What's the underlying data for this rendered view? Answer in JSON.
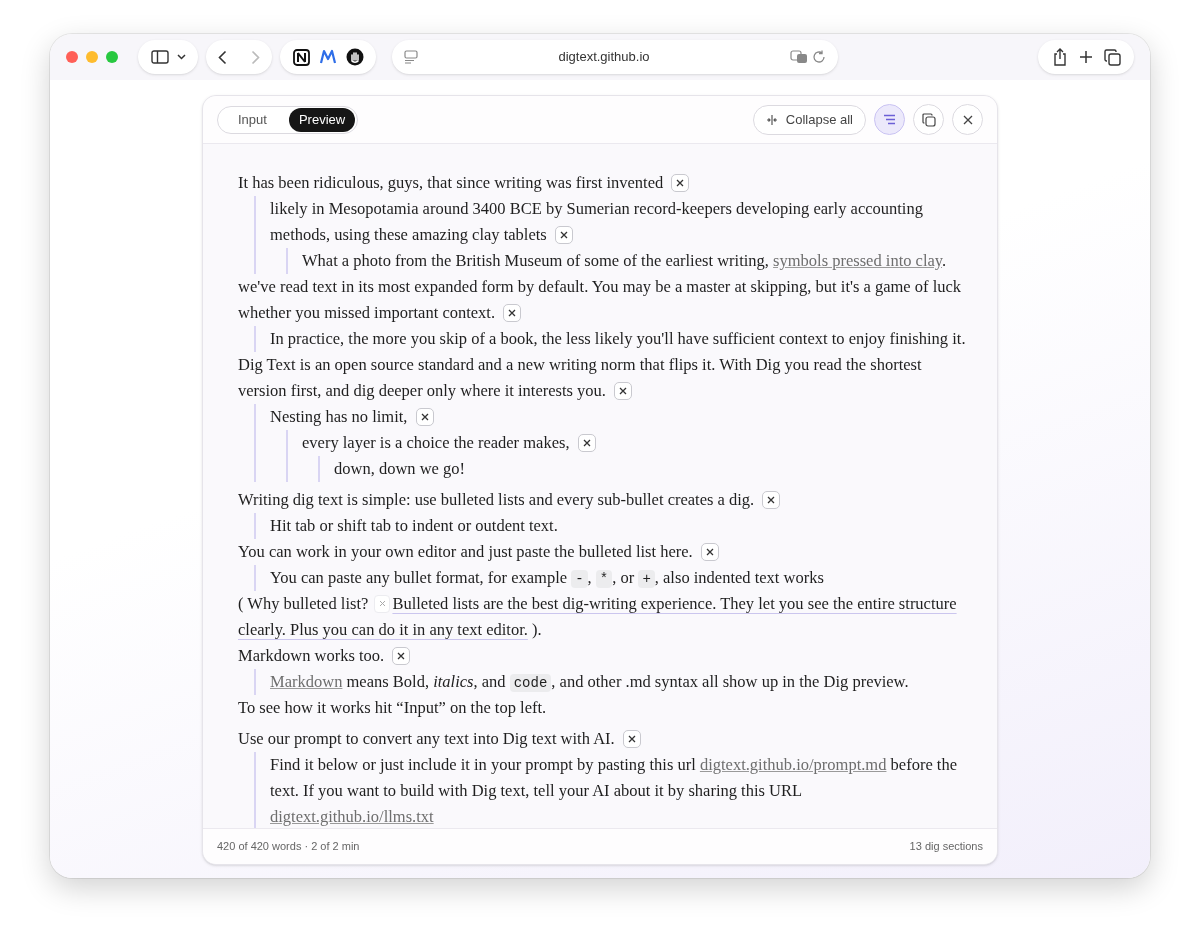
{
  "browser": {
    "url": "digtext.github.io"
  },
  "tabs": [
    {
      "label": "Input",
      "selected": false
    },
    {
      "label": "Preview",
      "selected": true
    }
  ],
  "toolbar": {
    "collapse_all": "Collapse all",
    "outline_selected": true
  },
  "sections": [
    [
      {
        "parts": [
          {
            "kind": "text",
            "text": "It has been ridiculous, guys, that since writing was first invented"
          },
          {
            "kind": "collapse"
          }
        ],
        "children": [
          {
            "parts": [
              {
                "kind": "text",
                "text": "likely in Mesopotamia around 3400 BCE by Sumerian record-keepers developing early accounting methods, using these amazing clay tablets"
              },
              {
                "kind": "collapse"
              }
            ],
            "children": [
              {
                "parts": [
                  {
                    "kind": "text",
                    "text": "What a photo from the British Museum of some of the earliest writing, "
                  },
                  {
                    "kind": "link",
                    "text": "symbols pressed into clay"
                  },
                  {
                    "kind": "text",
                    "text": "."
                  }
                ]
              }
            ]
          }
        ]
      },
      {
        "parts": [
          {
            "kind": "text",
            "text": "we've read text in its most expanded form by default. You may be a master at skipping, but it's a game of luck whether you missed important context."
          },
          {
            "kind": "collapse"
          }
        ],
        "children": [
          {
            "parts": [
              {
                "kind": "text",
                "text": "In practice, the more you skip of a book, the less likely you'll have sufficient context to enjoy finishing it."
              }
            ]
          }
        ]
      },
      {
        "parts": [
          {
            "kind": "text",
            "text": "Dig Text is an open source standard and a new writing norm that flips it. With Dig you read the shortest version first, and dig deeper only where it interests you."
          },
          {
            "kind": "collapse"
          }
        ],
        "children": [
          {
            "parts": [
              {
                "kind": "text",
                "text": "Nesting has no limit,"
              },
              {
                "kind": "collapse"
              }
            ],
            "children": [
              {
                "parts": [
                  {
                    "kind": "text",
                    "text": "every layer is a choice the reader makes,"
                  },
                  {
                    "kind": "collapse"
                  }
                ],
                "children": [
                  {
                    "parts": [
                      {
                        "kind": "text",
                        "text": "down, down we go!"
                      }
                    ]
                  }
                ]
              }
            ]
          }
        ]
      }
    ],
    [
      {
        "parts": [
          {
            "kind": "text",
            "text": "Writing dig text is simple: use bulleted lists and every sub-bullet creates a dig."
          },
          {
            "kind": "collapse"
          }
        ],
        "children": [
          {
            "parts": [
              {
                "kind": "text",
                "text": "Hit tab or shift tab to indent or outdent text."
              }
            ]
          }
        ]
      },
      {
        "parts": [
          {
            "kind": "text",
            "text": "You can work in your own editor and just paste the bulleted list here."
          },
          {
            "kind": "collapse"
          }
        ],
        "children": [
          {
            "parts": [
              {
                "kind": "text",
                "text": "You can paste any bullet format, for example "
              },
              {
                "kind": "code",
                "text": "-"
              },
              {
                "kind": "text",
                "text": ", "
              },
              {
                "kind": "code",
                "text": "*"
              },
              {
                "kind": "text",
                "text": ", or "
              },
              {
                "kind": "code",
                "text": "+"
              },
              {
                "kind": "text",
                "text": ", also indented text works"
              }
            ]
          }
        ]
      },
      {
        "parts": [
          {
            "kind": "text",
            "text": "( Why bulleted list? "
          },
          {
            "kind": "inline_collapse"
          },
          {
            "kind": "expanded",
            "text": "Bulleted lists are the best dig-writing experience. They let you see the entire structure clearly. Plus you can do it in any text editor."
          },
          {
            "kind": "text",
            "text": " )."
          }
        ]
      },
      {
        "parts": [
          {
            "kind": "text",
            "text": "Markdown works too."
          },
          {
            "kind": "collapse"
          }
        ],
        "children": [
          {
            "parts": [
              {
                "kind": "link",
                "text": "Markdown"
              },
              {
                "kind": "text",
                "text": " means Bold, *italics*, and "
              },
              {
                "kind": "code",
                "text": "code"
              },
              {
                "kind": "text",
                "text": ", and other .md syntax all show up in the Dig preview."
              }
            ]
          }
        ]
      },
      {
        "parts": [
          {
            "kind": "text",
            "text": "To see how it works hit “Input” on the top left."
          }
        ]
      }
    ],
    [
      {
        "parts": [
          {
            "kind": "text",
            "text": "Use our prompt to convert any text into Dig text with AI."
          },
          {
            "kind": "collapse"
          }
        ],
        "children": [
          {
            "parts": [
              {
                "kind": "text",
                "text": "Find it below or just include it in your prompt by pasting this url "
              },
              {
                "kind": "link",
                "text": "digtext.github.io/prompt.md"
              },
              {
                "kind": "text",
                "text": " before the text. If you want to build with Dig text, tell your AI about it by sharing this URL "
              },
              {
                "kind": "link",
                "text": "digtext.github.io/llms.txt"
              }
            ]
          }
        ]
      }
    ]
  ],
  "footer": {
    "left": "420 of 420 words · 2 of 2 min",
    "right": "13 dig sections"
  }
}
